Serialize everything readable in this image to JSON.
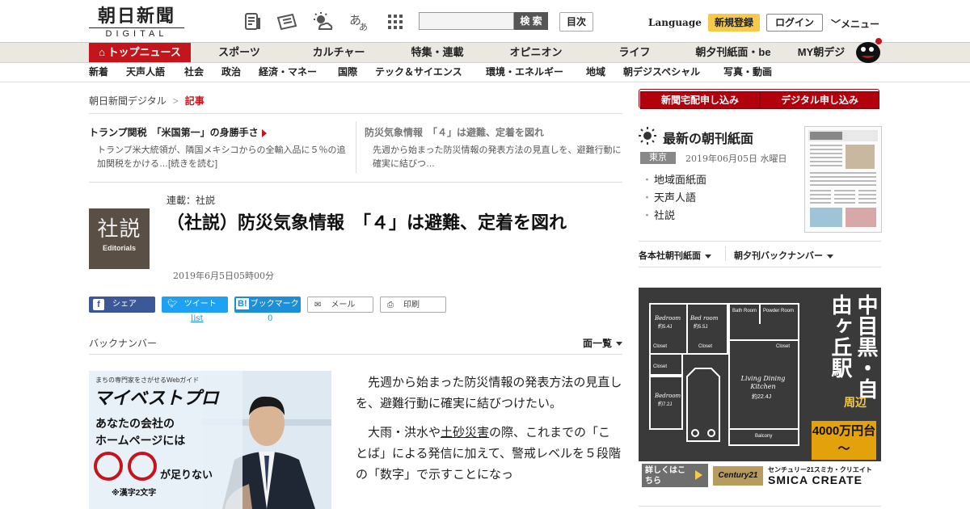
{
  "header": {
    "logo_jp": "朝日新聞",
    "logo_en": "DIGITAL",
    "search_button": "検 索",
    "mokuji_button": "目次",
    "language": "Language",
    "register": "新規登録",
    "login": "ログイン",
    "menu": "メニュー"
  },
  "nav_primary": [
    "トップニュース",
    "スポーツ",
    "カルチャー",
    "特集・連載",
    "オピニオン",
    "ライフ",
    "朝夕刊紙面・be",
    "MY朝デジ"
  ],
  "nav_secondary": [
    "新着",
    "天声人語",
    "社会",
    "政治",
    "経済・マネー",
    "国際",
    "テック＆サイエンス",
    "環境・エネルギー",
    "地域",
    "朝デジスペシャル",
    "写真・動画"
  ],
  "breadcrumb": {
    "home": "朝日新聞デジタル",
    "current": "記事"
  },
  "related": [
    {
      "headline": "トランプ関税　「米国第一」の身勝手さ",
      "summary": "トランプ米大統領が、隣国メキシコからの全輸入品に５％の追加関税をかける…[続きを読む]"
    },
    {
      "headline": "防災気象情報　「４」は避難、定着を図れ",
      "summary": "先週から始まった防災情報の発表方法の見直しを、避難行動に確実に結びつ…"
    }
  ],
  "article": {
    "badge_kanji": "社説",
    "badge_en": "Editorials",
    "series": "連載：社説",
    "title": "（社説）防災気象情報　「４」は避難、定着を図れ",
    "date": "2019年6月5日05時00分",
    "para1": "先週から始まった防災情報の発表方法の見直しを、避難行動に確実に結びつけたい。",
    "para2_a": "大雨・洪水や",
    "para2_link": "土砂災害",
    "para2_b": "の際、これまでの「ことば」による発信に加えて、警戒レベルを５段階の「数字」で示すことになっ"
  },
  "share": {
    "facebook": "シェア",
    "twitter": "ツイート",
    "hatena": "ブックマーク",
    "hatena_icon": "B!",
    "mail": "メール",
    "print": "印刷",
    "twitter_count": "list",
    "hatena_count": "0"
  },
  "backnumber": {
    "label": "バックナンバー",
    "dropdown": "面一覧"
  },
  "ad_left": {
    "tagline": "まちの専門家をさがせるWebガイド",
    "brand": "マイベストプロ",
    "line1": "あなたの会社の",
    "line2": "ホームページには",
    "line3": "が足りない",
    "note": "※漢字2文字"
  },
  "sidebar": {
    "btn_home": "新聞宅配申し込み",
    "btn_digital": "デジタル申し込み",
    "morning_title": "最新の朝刊紙面",
    "region": "東京",
    "morning_date": "2019年06月05日 水曜日",
    "morning_links": [
      "地域面紙面",
      "天声人語",
      "社説"
    ],
    "dd_papers": "各本社朝刊紙面",
    "dd_back": "朝夕刊バックナンバー"
  },
  "ad_right": {
    "headline": "中目黒・自由ヶ丘駅",
    "near": "周辺",
    "price": "4000万円台～",
    "cta": "詳しくはこちら",
    "company": "センチュリー21スミカ・クリエイト",
    "company_en": "SMICA CREATE",
    "brand_logo": "Century21",
    "rooms": [
      "Bedroom",
      "Bed room",
      "Bath Room",
      "Powder Room",
      "Closet",
      "Closet",
      "Closet",
      "Closet",
      "Bedroom",
      "Living Dining Kitchen",
      "Balcony"
    ],
    "areas": [
      "約5.4J",
      "約5.5J",
      "約7.2J",
      "約22.4J"
    ]
  },
  "colors": {
    "brand_red": "#c4151c",
    "register_yellow": "#f6c94a",
    "facebook": "#3b5998",
    "twitter": "#1da1f2"
  }
}
